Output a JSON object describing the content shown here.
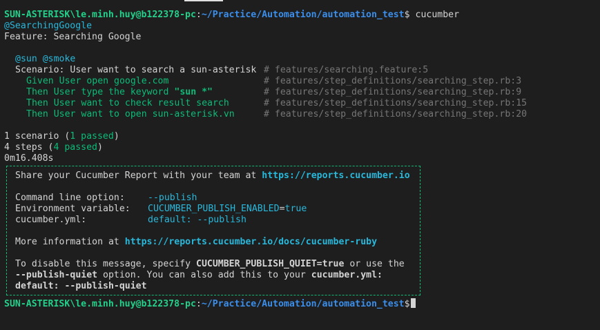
{
  "prompt": {
    "user_host": "SUN-ASTERISK\\le.minh.huy@b122378-pc",
    "separator": ":",
    "path": "~/Practice/Automation/automation_test",
    "symbol": "$",
    "command": " cucumber"
  },
  "feature": {
    "tag": "@SearchingGoogle",
    "title": "Feature: Searching Google"
  },
  "scenario": {
    "tags": "@sun @smoke",
    "title": "Scenario: User want to search a sun-asterisk",
    "location": "# features/searching.feature:5",
    "steps": [
      {
        "text": "Given User open google.com",
        "location": "# features/step_definitions/searching_step.rb:3"
      },
      {
        "text_before": "Then User type the keyword ",
        "text_bold": "\"sun *\"",
        "location": "# features/step_definitions/searching_step.rb:9"
      },
      {
        "text": "Then User want to check result search",
        "location": "# features/step_definitions/searching_step.rb:15"
      },
      {
        "text": "Then User want to open sun-asterisk.vn",
        "location": "# features/step_definitions/searching_step.rb:20"
      }
    ]
  },
  "summary": {
    "scenarios_prefix": "1 scenario (",
    "scenarios_passed": "1 passed",
    "scenarios_suffix": ")",
    "steps_prefix": "4 steps (",
    "steps_passed": "4 passed",
    "steps_suffix": ")",
    "duration": "0m16.408s"
  },
  "report_box": {
    "share_text": "Share your Cucumber Report with your team at ",
    "share_url": "https://reports.cucumber.io",
    "cli_label": "Command line option:",
    "cli_value": "--publish",
    "env_label": "Environment variable:",
    "env_name": "CUCUMBER_PUBLISH_ENABLED",
    "env_eq": "=",
    "env_value": "true",
    "yml_label": "cucumber.yml:",
    "yml_value": "default: --publish",
    "more_text": "More information at ",
    "more_url": "https://reports.cucumber.io/docs/cucumber-ruby",
    "disable_1a": "To disable this message, specify ",
    "disable_1b": "CUCUMBER_PUBLISH_QUIET=true",
    "disable_1c": " or use the",
    "disable_2a": "--publish-quiet",
    "disable_2b": " option. You can also add this to your ",
    "disable_2c": "cucumber.yml:",
    "disable_3": "default: --publish-quiet"
  },
  "colors": {
    "background": "#1e1e1e",
    "prompt_green": "#23d18b",
    "path_blue": "#3b8eea",
    "cyan": "#29b8db",
    "pass_green": "#0dbc79",
    "comment_gray": "#767676"
  }
}
